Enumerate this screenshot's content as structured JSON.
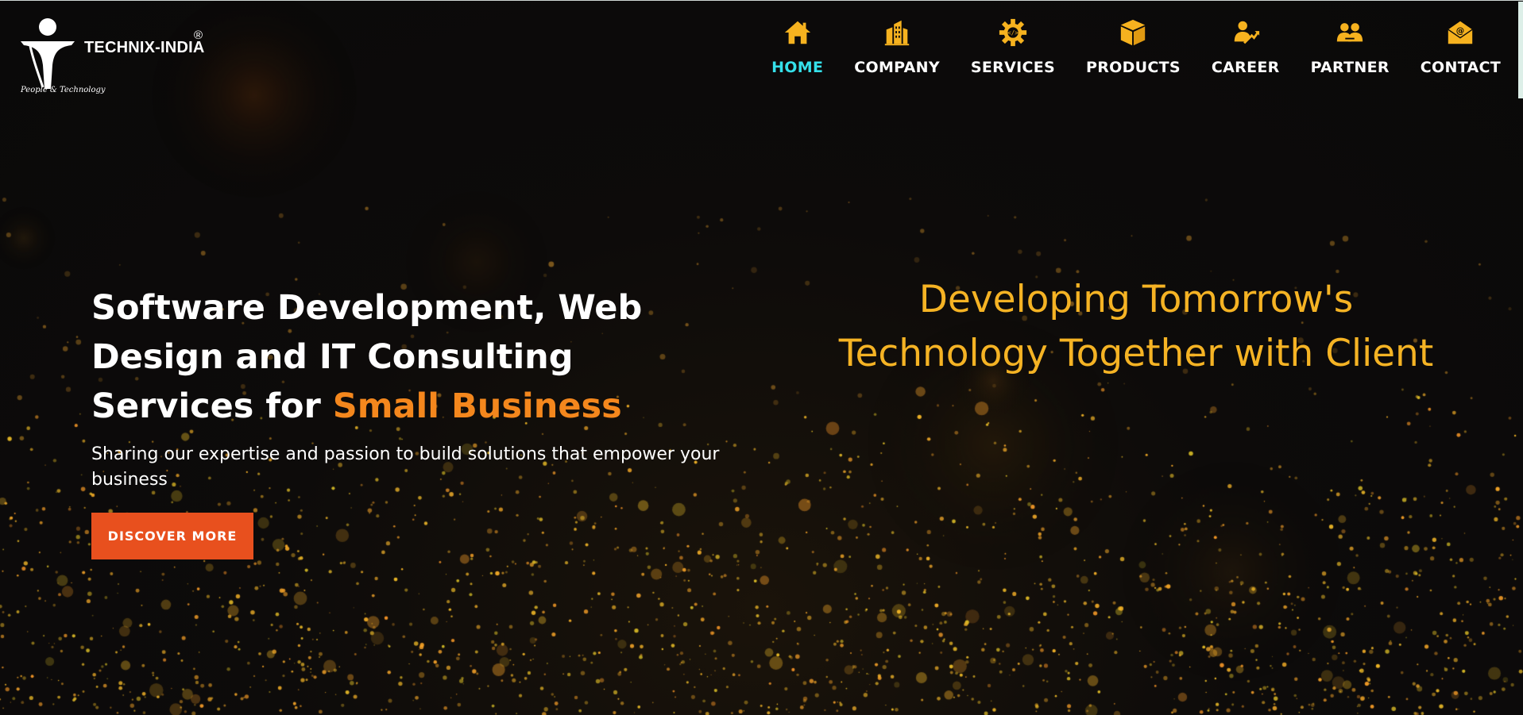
{
  "brand": {
    "name": "TECHNIX-INDIA",
    "registered_mark": "®",
    "tagline": "People & Technology"
  },
  "colors": {
    "background": "#0b0a0a",
    "accent_orange": "#f4871d",
    "accent_gold": "#f5b324",
    "button_red": "#e8501e",
    "active_nav_cyan": "#35e0ea",
    "icon_gold": "#f6b21f"
  },
  "nav": {
    "items": [
      {
        "label": "HOME",
        "icon": "home-icon",
        "active": true
      },
      {
        "label": "COMPANY",
        "icon": "building-icon",
        "active": false
      },
      {
        "label": "SERVICES",
        "icon": "code-gear-icon",
        "active": false
      },
      {
        "label": "PRODUCTS",
        "icon": "box-icon",
        "active": false
      },
      {
        "label": "CAREER",
        "icon": "person-growth-icon",
        "active": false
      },
      {
        "label": "PARTNER",
        "icon": "partners-icon",
        "active": false
      },
      {
        "label": "CONTACT",
        "icon": "envelope-at-icon",
        "active": false
      }
    ]
  },
  "hero": {
    "title_main": "Software Development, Web Design and IT Consulting Services for ",
    "title_accent": "Small Business",
    "subtitle": "Sharing our expertise and passion to build solutions that empower your business",
    "cta_label": "DISCOVER MORE"
  },
  "slogan": {
    "line1": "Developing Tomorrow's",
    "line2": "Technology Together with Client"
  }
}
